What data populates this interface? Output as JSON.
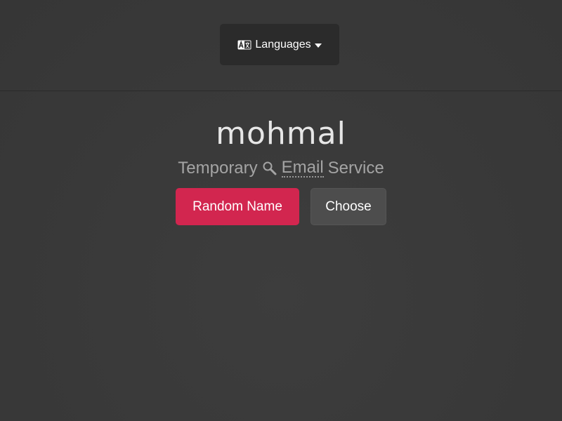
{
  "header": {
    "languages_label": "Languages",
    "languages_icon": "translate-icon",
    "dropdown_icon": "caret-down-icon"
  },
  "logo": {
    "text": "mohmal"
  },
  "tagline": {
    "before": "Temporary",
    "icon": "search-icon",
    "email": "Email",
    "after": "Service"
  },
  "actions": {
    "random_label": "Random Name",
    "choose_label": "Choose"
  },
  "colors": {
    "accent": "#d2264f",
    "background": "#3a3a3a",
    "secondary_button": "#4d4d4d"
  }
}
